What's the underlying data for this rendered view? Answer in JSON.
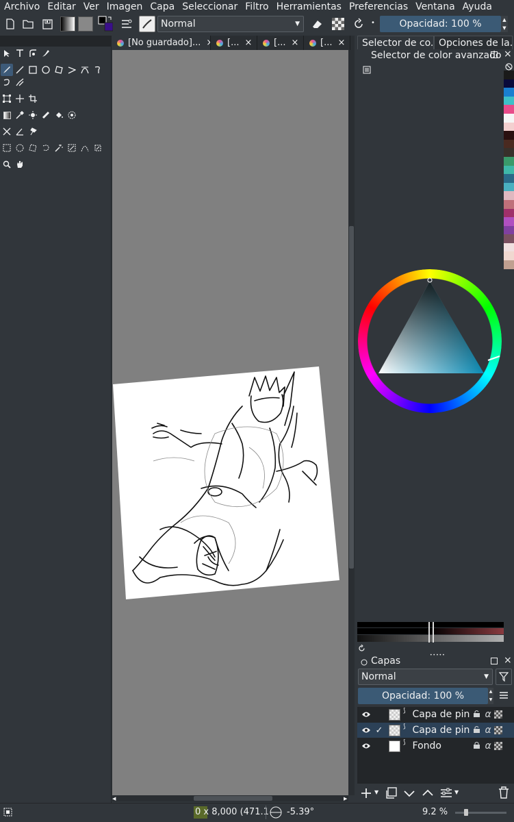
{
  "menu": [
    "Archivo",
    "Editar",
    "Ver",
    "Imagen",
    "Capa",
    "Seleccionar",
    "Filtro",
    "Herramientas",
    "Preferencias",
    "Ventana",
    "Ayuda"
  ],
  "toolbar": {
    "blend_mode": "Normal",
    "opacity": "Opacidad: 100 %"
  },
  "tabs": [
    {
      "label": "[No guardado]...",
      "close": "×"
    },
    {
      "label": "[...",
      "close": "×"
    },
    {
      "label": "[...",
      "close": "×"
    },
    {
      "label": "[...",
      "close": "×"
    }
  ],
  "dockers": {
    "tab_color": "Selector de co...",
    "tab_options": "Opciones de la...",
    "color_panel_title": "Selector de color avanzado"
  },
  "swatch_colors": [
    "#1a1a1a",
    "#0a0a3a",
    "#1a7fd0",
    "#3ec0c8",
    "#e84c8a",
    "#f6f6f6",
    "#f3d0d0",
    "#2a1010",
    "#4a2a20",
    "#38302a",
    "#3a9a6a",
    "#3fb8a8",
    "#2a6a88",
    "#4ab0c0",
    "#e0b8c0",
    "#c0707a",
    "#a0306a",
    "#b050c0",
    "#8040a0",
    "#7a5060",
    "#f0e0e0",
    "#f0d8d0",
    "#c0a090"
  ],
  "colors": {
    "accent": "#3d5a78",
    "canvas_bg": "#808080",
    "panel_bg": "#31363b",
    "wheel_selected": "#1a6b8f"
  },
  "layers": {
    "title": "Capas",
    "blend_mode": "Normal",
    "opacity": "Opacidad: 100 %",
    "items": [
      {
        "name": "Capa de pin...",
        "checked": "",
        "selected": false
      },
      {
        "name": "Capa de pin...",
        "checked": "✓",
        "selected": true
      },
      {
        "name": "Fondo",
        "checked": "",
        "selected": false
      }
    ]
  },
  "status": {
    "size": "0 x 8,000 (471.1",
    "rotation": "-5.39°",
    "zoom": "9.2 %"
  }
}
